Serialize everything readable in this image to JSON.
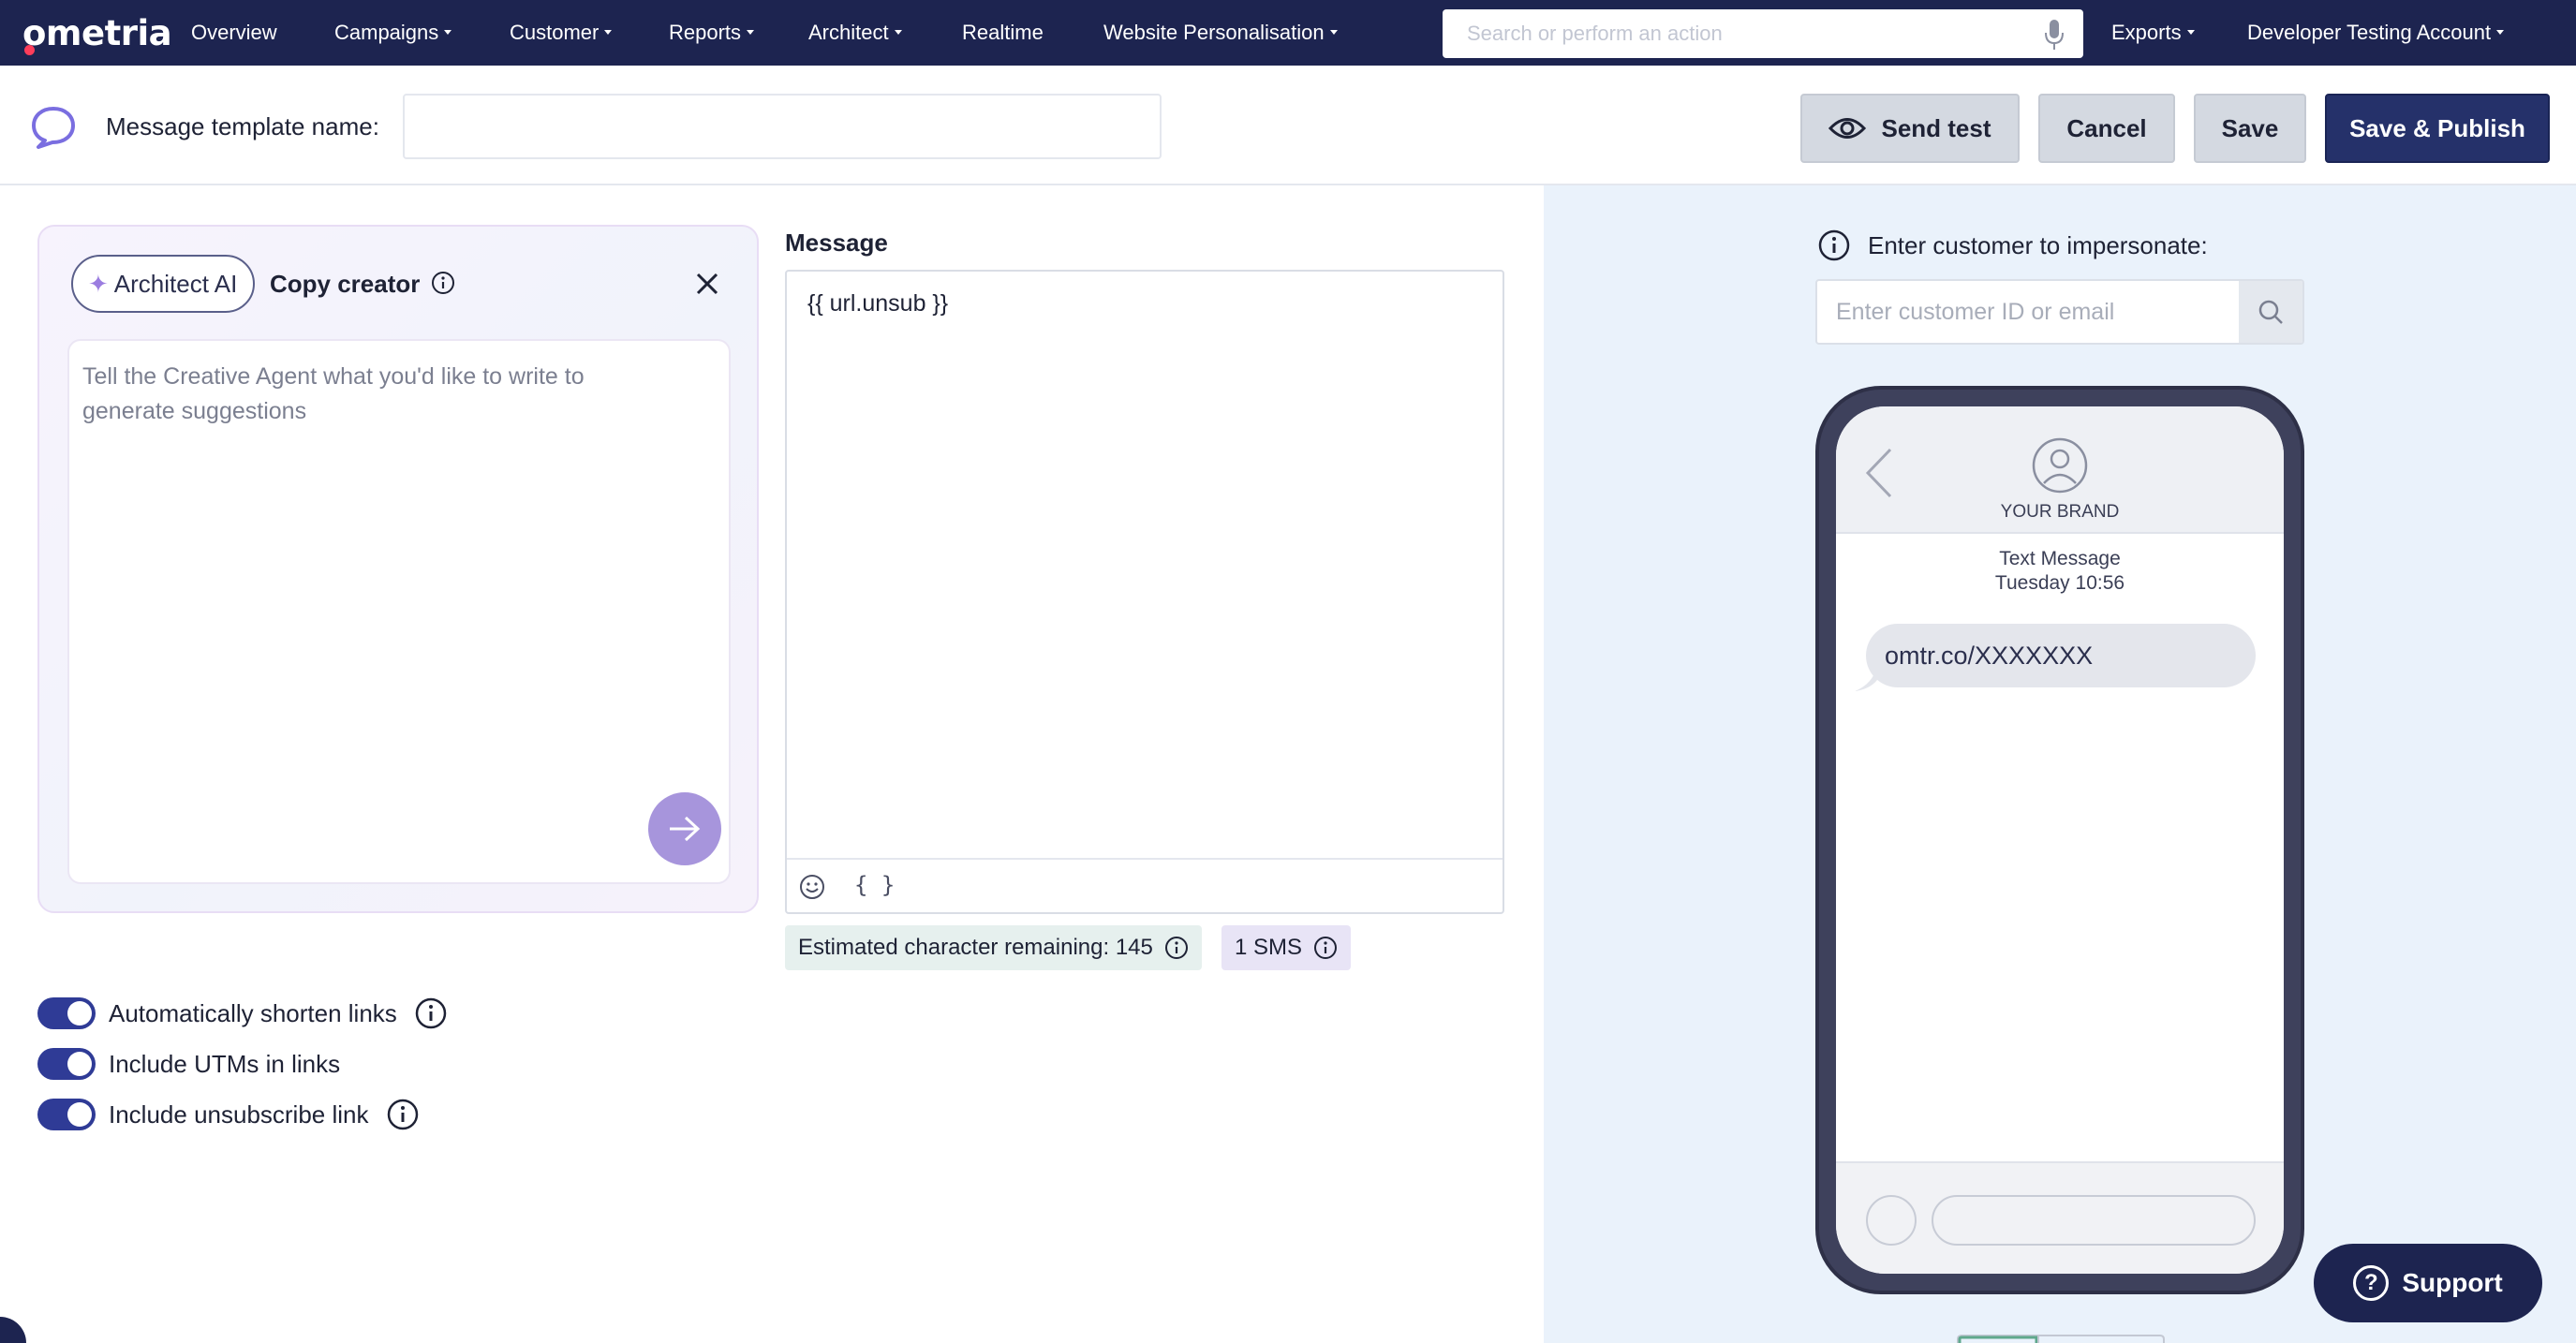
{
  "nav": {
    "logo": "ometria",
    "items": [
      {
        "label": "Overview",
        "has_caret": false
      },
      {
        "label": "Campaigns",
        "has_caret": true
      },
      {
        "label": "Customer",
        "has_caret": true
      },
      {
        "label": "Reports",
        "has_caret": true
      },
      {
        "label": "Architect",
        "has_caret": true
      },
      {
        "label": "Realtime",
        "has_caret": false
      },
      {
        "label": "Website Personalisation",
        "has_caret": true
      }
    ],
    "search_placeholder": "Search or perform an action",
    "exports": "Exports",
    "account": "Developer Testing Account"
  },
  "header": {
    "template_name_label": "Message template name:",
    "template_name_value": "",
    "send_test": "Send test",
    "cancel": "Cancel",
    "save": "Save",
    "save_publish": "Save & Publish"
  },
  "ai_panel": {
    "badge": "Architect AI",
    "title": "Copy creator",
    "placeholder": "Tell the Creative Agent what you'd like to write to generate suggestions"
  },
  "message": {
    "label": "Message",
    "content": "{{ url.unsub }}",
    "chars_remaining": "Estimated character remaining: 145",
    "sms_count": "1 SMS"
  },
  "toggles": [
    {
      "label": "Automatically shorten links",
      "on": true,
      "info": true
    },
    {
      "label": "Include UTMs in links",
      "on": true,
      "info": false
    },
    {
      "label": "Include unsubscribe link",
      "on": true,
      "info": true
    }
  ],
  "preview": {
    "impersonate_label": "Enter customer to impersonate:",
    "impersonate_placeholder": "Enter customer ID or email",
    "brand": "YOUR BRAND",
    "meta_line1": "Text Message",
    "meta_line2": "Tuesday 10:56",
    "bubble_text": "omtr.co/XXXXXXX"
  },
  "support": "Support",
  "colors": {
    "nav_bg": "#1d2450",
    "primary": "#25316a",
    "toggle_on": "#2f3b96",
    "ai_accent": "#a795dc",
    "preview_bg": "#eaf2fb"
  }
}
